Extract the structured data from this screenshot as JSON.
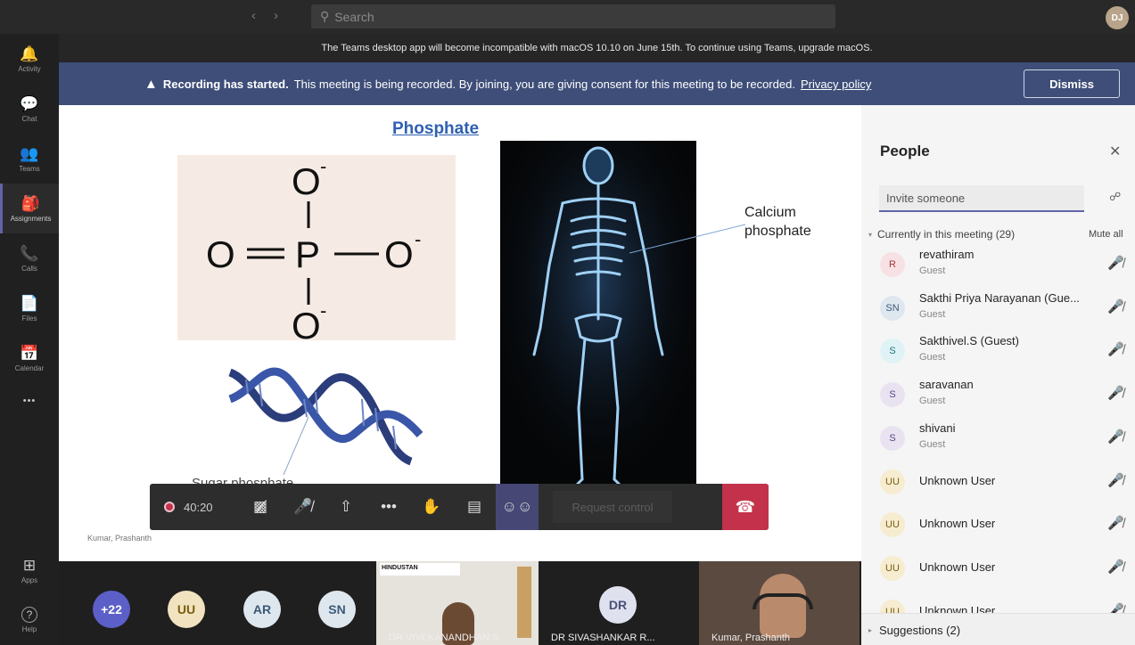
{
  "topbar": {
    "search_placeholder": "Search",
    "me_initials": "DJ"
  },
  "rail": [
    {
      "icon": "bell-icon",
      "glyph": "🔔",
      "label": "Activity"
    },
    {
      "icon": "chat-icon",
      "glyph": "💬",
      "label": "Chat"
    },
    {
      "icon": "teams-icon",
      "glyph": "👥",
      "label": "Teams"
    },
    {
      "icon": "assignments-icon",
      "glyph": "🎒",
      "label": "Assignments"
    },
    {
      "icon": "phone-icon",
      "glyph": "📞",
      "label": "Calls"
    },
    {
      "icon": "files-icon",
      "glyph": "📄",
      "label": "Files"
    },
    {
      "icon": "calendar-icon",
      "glyph": "📅",
      "label": "Calendar"
    },
    {
      "icon": "more-icon",
      "glyph": "•••",
      "label": ""
    },
    {
      "icon": "apps-icon",
      "glyph": "⊞",
      "label": "Apps"
    },
    {
      "icon": "help-icon",
      "glyph": "?",
      "label": "Help"
    }
  ],
  "banner_upgrade": "The Teams desktop app will become incompatible with macOS 10.10 on June 15th. To continue using Teams, upgrade macOS.",
  "banner_recording": {
    "bold": "Recording has started.",
    "text": "This meeting is being recorded. By joining, you are giving consent for this meeting to be recorded.",
    "link": "Privacy policy",
    "dismiss": "Dismiss"
  },
  "slide": {
    "title": "Phosphate",
    "formula": {
      "center": "P",
      "oxygen": "O",
      "charge": "-"
    },
    "calcium_label_1": "Calcium",
    "calcium_label_2": "phosphate",
    "sugar_label": "Sugar phosphate",
    "presenter": "Kumar, Prashanth"
  },
  "controls": {
    "timer": "40:20",
    "request_control": "Request control"
  },
  "strip": {
    "bubbles": [
      {
        "text": "+22",
        "bg": "#5b5fc7",
        "fg": "#ffffff"
      },
      {
        "text": "UU",
        "bg": "#f1e3c0",
        "fg": "#7a5c10"
      },
      {
        "text": "AR",
        "bg": "#dfe7ee",
        "fg": "#3c5a78"
      },
      {
        "text": "SN",
        "bg": "#dfe7ee",
        "fg": "#3c5a78"
      }
    ],
    "tile_hindustan_brand": "HINDUSTAN",
    "tile1_name": "DR VIVEKANANDHAN S",
    "tile2_initials": "DR",
    "tile2_name": "DR SIVASHANKAR R...",
    "tile3_name": "Kumar, Prashanth"
  },
  "people": {
    "title": "People",
    "invite_placeholder": "Invite someone",
    "section": "Currently in this meeting (29)",
    "mute_all": "Mute all",
    "list": [
      {
        "initials": "R",
        "name": "revathiram",
        "role": "Guest",
        "bg": "#f8e1e4",
        "fg": "#a4373a"
      },
      {
        "initials": "SN",
        "name": "Sakthi Priya Narayanan (Gue...",
        "role": "Guest",
        "bg": "#dfe7ee",
        "fg": "#3c5a78"
      },
      {
        "initials": "S",
        "name": "Sakthivel.S (Guest)",
        "role": "Guest",
        "bg": "#dff3f6",
        "fg": "#22737f"
      },
      {
        "initials": "S",
        "name": "saravanan",
        "role": "Guest",
        "bg": "#e9e3f1",
        "fg": "#5a4483"
      },
      {
        "initials": "S",
        "name": "shivani",
        "role": "Guest",
        "bg": "#e9e3f1",
        "fg": "#5a4483"
      },
      {
        "initials": "UU",
        "name": "Unknown User",
        "role": "",
        "bg": "#f6ecd0",
        "fg": "#7a5c10"
      },
      {
        "initials": "UU",
        "name": "Unknown User",
        "role": "",
        "bg": "#f6ecd0",
        "fg": "#7a5c10"
      },
      {
        "initials": "UU",
        "name": "Unknown User",
        "role": "",
        "bg": "#f6ecd0",
        "fg": "#7a5c10"
      },
      {
        "initials": "UU",
        "name": "Unknown User",
        "role": "",
        "bg": "#f6ecd0",
        "fg": "#7a5c10"
      }
    ],
    "suggestions": "Suggestions (2)"
  }
}
